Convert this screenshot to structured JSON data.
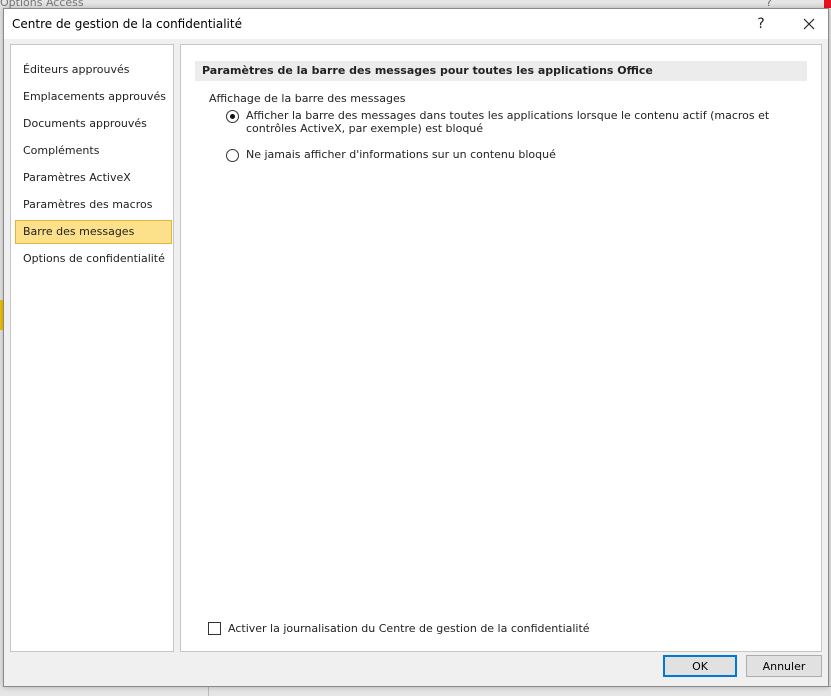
{
  "background_window": {
    "title_fragment": "Options Access",
    "help_label": "?"
  },
  "dialog": {
    "title": "Centre de gestion de la confidentialité",
    "help_label": "?",
    "close_icon": "close-icon"
  },
  "nav": {
    "items": [
      {
        "label": "Éditeurs approuvés"
      },
      {
        "label": "Emplacements approuvés"
      },
      {
        "label": "Documents approuvés"
      },
      {
        "label": "Compléments"
      },
      {
        "label": "Paramètres ActiveX"
      },
      {
        "label": "Paramètres des macros"
      },
      {
        "label": "Barre des messages",
        "selected": true
      },
      {
        "label": "Options de confidentialité"
      }
    ]
  },
  "content": {
    "section_header": "Paramètres de la barre des messages pour toutes les applications Office",
    "group_label": "Affichage de la barre des messages",
    "radio_options": [
      {
        "label": "Afficher la barre des messages dans toutes les applications lorsque le contenu actif (macros et contrôles ActiveX, par exemple) est bloqué",
        "checked": true
      },
      {
        "label": "Ne jamais afficher d'informations sur un contenu bloqué",
        "checked": false
      }
    ],
    "logging_checkbox": {
      "label": "Activer la journalisation du Centre de gestion de la confidentialité",
      "checked": false
    }
  },
  "buttons": {
    "ok_label": "OK",
    "cancel_label": "Annuler"
  },
  "colors": {
    "selected_bg": "#fde08a",
    "selected_border": "#e5b23c",
    "focus_border": "#0078d7"
  }
}
